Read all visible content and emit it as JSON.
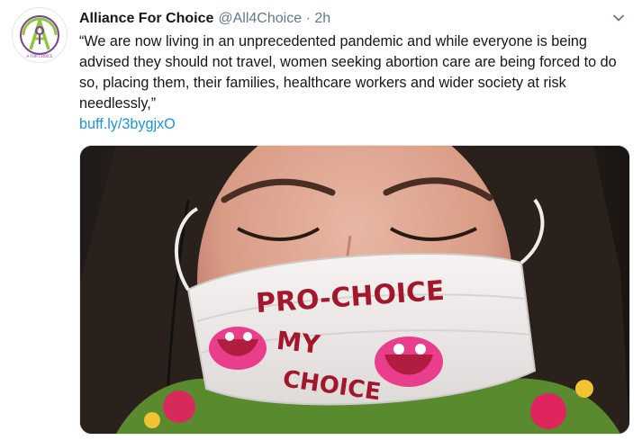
{
  "tweet": {
    "author_name": "Alliance For Choice",
    "author_handle": "@All4Choice",
    "separator": "·",
    "timestamp": "2h",
    "text": "“We are now living in an unprecedented pandemic and while everyone is being advised they should not travel, women seeking abortion care are being forced to do so, placing them, their families, healthcare workers and wider society at risk needlessly,”",
    "link": "buff.ly/3bygjxO",
    "avatar_logo_text": "A FOR CHOICE",
    "media": {
      "mask_line_1": "PRO-CHOICE",
      "mask_line_2": "MY",
      "mask_line_3": "CHOICE"
    }
  },
  "colors": {
    "link": "#1b95e0",
    "secondary_text": "#657786",
    "primary_text": "#14171a",
    "avatar_green": "#8dc63f",
    "avatar_purple": "#7b3f98",
    "mask_text": "#a3172d"
  },
  "icons": {
    "menu": "chevron-down-icon",
    "avatar": "alliance-for-choice-logo"
  }
}
